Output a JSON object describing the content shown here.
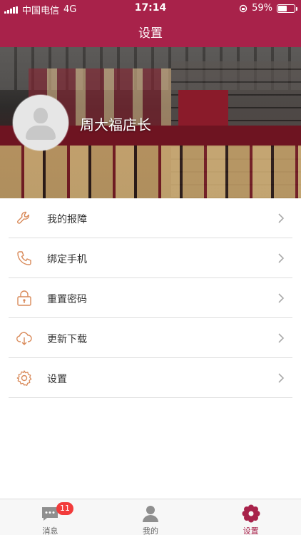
{
  "status_bar": {
    "carrier": "中国电信",
    "network": "4G",
    "time": "17:14",
    "battery": "59%",
    "battery_level": 0.59
  },
  "header": {
    "title": "设置"
  },
  "profile": {
    "store_name": "周大福店长"
  },
  "menu": {
    "items": [
      {
        "label": "我的报障",
        "icon": "wrench-icon"
      },
      {
        "label": "绑定手机",
        "icon": "phone-icon"
      },
      {
        "label": "重置密码",
        "icon": "lock-icon"
      },
      {
        "label": "更新下载",
        "icon": "cloud-download-icon"
      },
      {
        "label": "设置",
        "icon": "gear-icon"
      }
    ]
  },
  "tabbar": {
    "tabs": [
      {
        "label": "消息",
        "icon": "message-icon",
        "badge": "11"
      },
      {
        "label": "我的",
        "icon": "person-icon"
      },
      {
        "label": "设置",
        "icon": "flower-gear-icon",
        "active": true
      }
    ]
  },
  "colors": {
    "brand": "#a8224a",
    "icon_orange": "#d98a5a",
    "badge": "#f23b3b"
  }
}
